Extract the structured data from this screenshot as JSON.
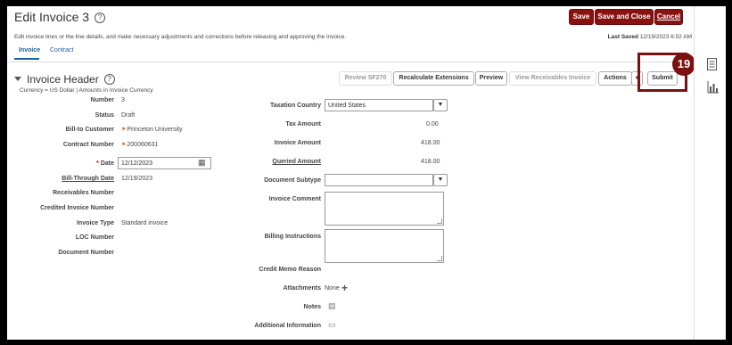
{
  "header": {
    "title": "Edit Invoice 3",
    "save_label": "Save",
    "save_close_label": "Save and Close",
    "cancel_label": "Cancel",
    "instructions": "Edit invoice lines or the line details, and make necessary adjustments and corrections before releasing and approving the invoice.",
    "last_saved_label": "Last Saved",
    "last_saved_value": "12/19/2023 6:52 AM"
  },
  "tabs": [
    {
      "label": "Invoice"
    },
    {
      "label": "Contract"
    }
  ],
  "section": {
    "title": "Invoice Header",
    "subtitle": "Currency = US Dollar | Amounts in Invoice Currency"
  },
  "toolbar": {
    "review": "Review SF270",
    "recalc": "Recalculate Extensions",
    "preview": "Preview",
    "view_receivables": "View Receivables Invoice",
    "actions": "Actions",
    "submit": "Submit"
  },
  "callout": {
    "number": "19"
  },
  "left_fields": {
    "number": {
      "label": "Number",
      "value": "3"
    },
    "status": {
      "label": "Status",
      "value": "Draft"
    },
    "bill_to": {
      "label": "Bill-to Customer",
      "value": "Princeton University"
    },
    "contract": {
      "label": "Contract Number",
      "value": "200060631"
    },
    "date": {
      "label": "Date",
      "value": "12/12/2023"
    },
    "bill_through": {
      "label": "Bill-Through Date",
      "value": "12/19/2023"
    },
    "receivables": {
      "label": "Receivables Number"
    },
    "credited": {
      "label": "Credited Invoice Number"
    },
    "invoice_type": {
      "label": "Invoice Type",
      "value": "Standard invoice"
    },
    "loc": {
      "label": "LOC Number"
    },
    "document": {
      "label": "Document Number"
    }
  },
  "right_fields": {
    "taxation_country": {
      "label": "Taxation Country",
      "value": "United States"
    },
    "tax_amount": {
      "label": "Tax Amount",
      "value": "0.00"
    },
    "invoice_amount": {
      "label": "Invoice Amount",
      "value": "418.00"
    },
    "queried_amount": {
      "label": "Queried Amount",
      "value": "418.00"
    },
    "document_subtype": {
      "label": "Document Subtype"
    },
    "invoice_comment": {
      "label": "Invoice Comment"
    },
    "billing_instructions": {
      "label": "Billing Instructions"
    },
    "credit_memo": {
      "label": "Credit Memo Reason"
    },
    "attachments": {
      "label": "Attachments",
      "value": "None"
    },
    "notes": {
      "label": "Notes"
    },
    "additional": {
      "label": "Additional Information"
    }
  },
  "colors": {
    "accent_red": "#8a1111",
    "link_blue": "#1a5f9e",
    "callout": "#7a1010"
  },
  "icons": [
    "help-icon",
    "calendar-icon",
    "add-icon",
    "notes-icon",
    "additional-info-icon",
    "document-panel-icon",
    "chart-panel-icon"
  ]
}
